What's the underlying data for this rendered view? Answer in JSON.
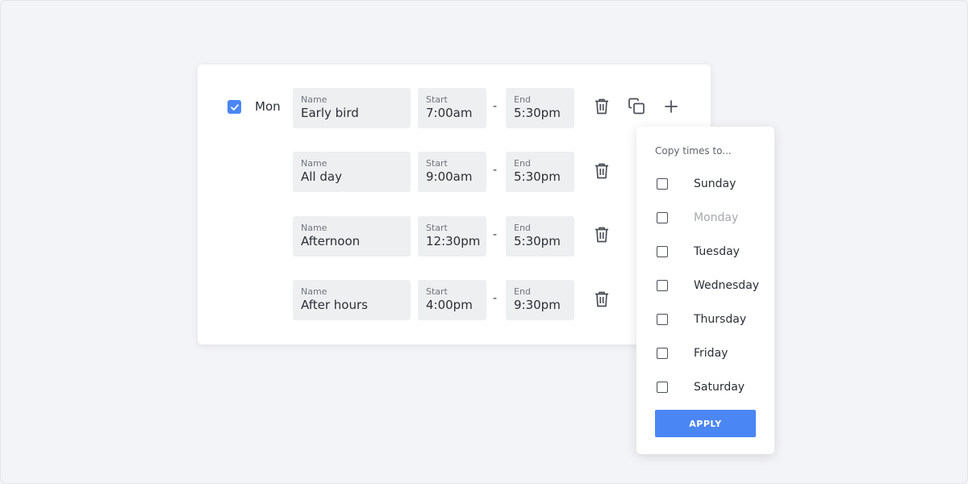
{
  "day": {
    "label": "Mon",
    "checked": true
  },
  "slots": [
    {
      "name_label": "Name",
      "name": "Early bird",
      "start_label": "Start",
      "start": "7:00am",
      "separator": "-",
      "end_label": "End",
      "end": "5:30pm"
    },
    {
      "name_label": "Name",
      "name": "All day",
      "start_label": "Start",
      "start": "9:00am",
      "separator": "-",
      "end_label": "End",
      "end": "5:30pm"
    },
    {
      "name_label": "Name",
      "name": "Afternoon",
      "start_label": "Start",
      "start": "12:30pm",
      "separator": "-",
      "end_label": "End",
      "end": "5:30pm"
    },
    {
      "name_label": "Name",
      "name": "After hours",
      "start_label": "Start",
      "start": "4:00pm",
      "separator": "-",
      "end_label": "End",
      "end": "9:30pm"
    }
  ],
  "icons": {
    "delete": "trash-icon",
    "copy": "copy-icon",
    "add": "plus-icon"
  },
  "copy_popup": {
    "title": "Copy times to...",
    "options": [
      {
        "label": "Sunday",
        "disabled": false
      },
      {
        "label": "Monday",
        "disabled": true
      },
      {
        "label": "Tuesday",
        "disabled": false
      },
      {
        "label": "Wednesday",
        "disabled": false
      },
      {
        "label": "Thursday",
        "disabled": false
      },
      {
        "label": "Friday",
        "disabled": false
      },
      {
        "label": "Saturday",
        "disabled": false
      }
    ],
    "apply_label": "APPLY"
  },
  "colors": {
    "accent": "#4a86f4",
    "background": "#f3f4f7",
    "field": "#eeeff1"
  }
}
